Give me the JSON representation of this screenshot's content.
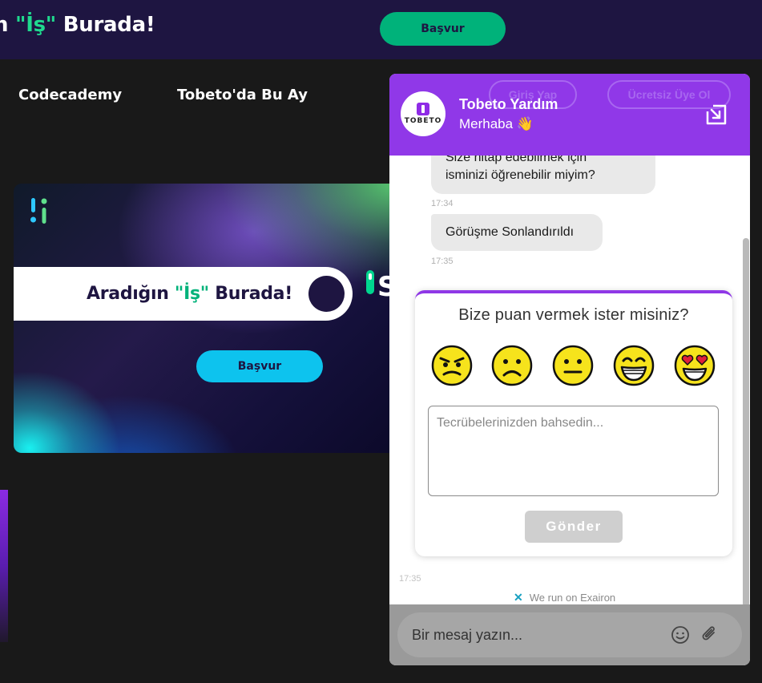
{
  "topbar": {
    "title_prefix": "n ",
    "title_quote_open": "\"",
    "title_word": "İş",
    "title_quote_close": "\"",
    "title_suffix": " Burada!",
    "apply_label": "Başvur"
  },
  "nav": {
    "items": [
      "Codecademy",
      "Tobeto'da Bu Ay"
    ],
    "login_label": "Giriş Yap",
    "signup_label": "Ücretsiz Üye Ol"
  },
  "hero": {
    "text_prefix": "Aradığın ",
    "text_quote_open": "\"",
    "text_word": "İş",
    "text_quote_close": "\"",
    "text_suffix": " Burada!",
    "apply_label": "Başvur",
    "partial_letter": "S"
  },
  "chat": {
    "title": "Tobeto Yardım",
    "subtitle": "Merhaba 👋",
    "avatar_text": "TOBETO",
    "messages": [
      {
        "text_line1": "Size hitap edebilmek için",
        "text_line2": "isminizi öğrenebilir miyim?",
        "time": "17:34"
      },
      {
        "text": "Görüşme Sonlandırıldı",
        "time": "17:35"
      }
    ],
    "rating": {
      "question": "Bize puan vermek ister misiniz?",
      "emojis": [
        "angry-face-icon",
        "sad-face-icon",
        "neutral-face-icon",
        "grinning-face-icon",
        "heart-eyes-face-icon"
      ],
      "feedback_placeholder": "Tecrübelerinizden bahsedin...",
      "send_label": "Gönder"
    },
    "footer_time": "17:35",
    "powered_by": "We run on Exairon",
    "composer_placeholder": "Bir mesaj yazın..."
  },
  "colors": {
    "topbar_bg": "#1e1541",
    "accent_green": "#00b27a",
    "chat_purple": "#9038e8",
    "hero_apply": "#0dc3ee"
  }
}
